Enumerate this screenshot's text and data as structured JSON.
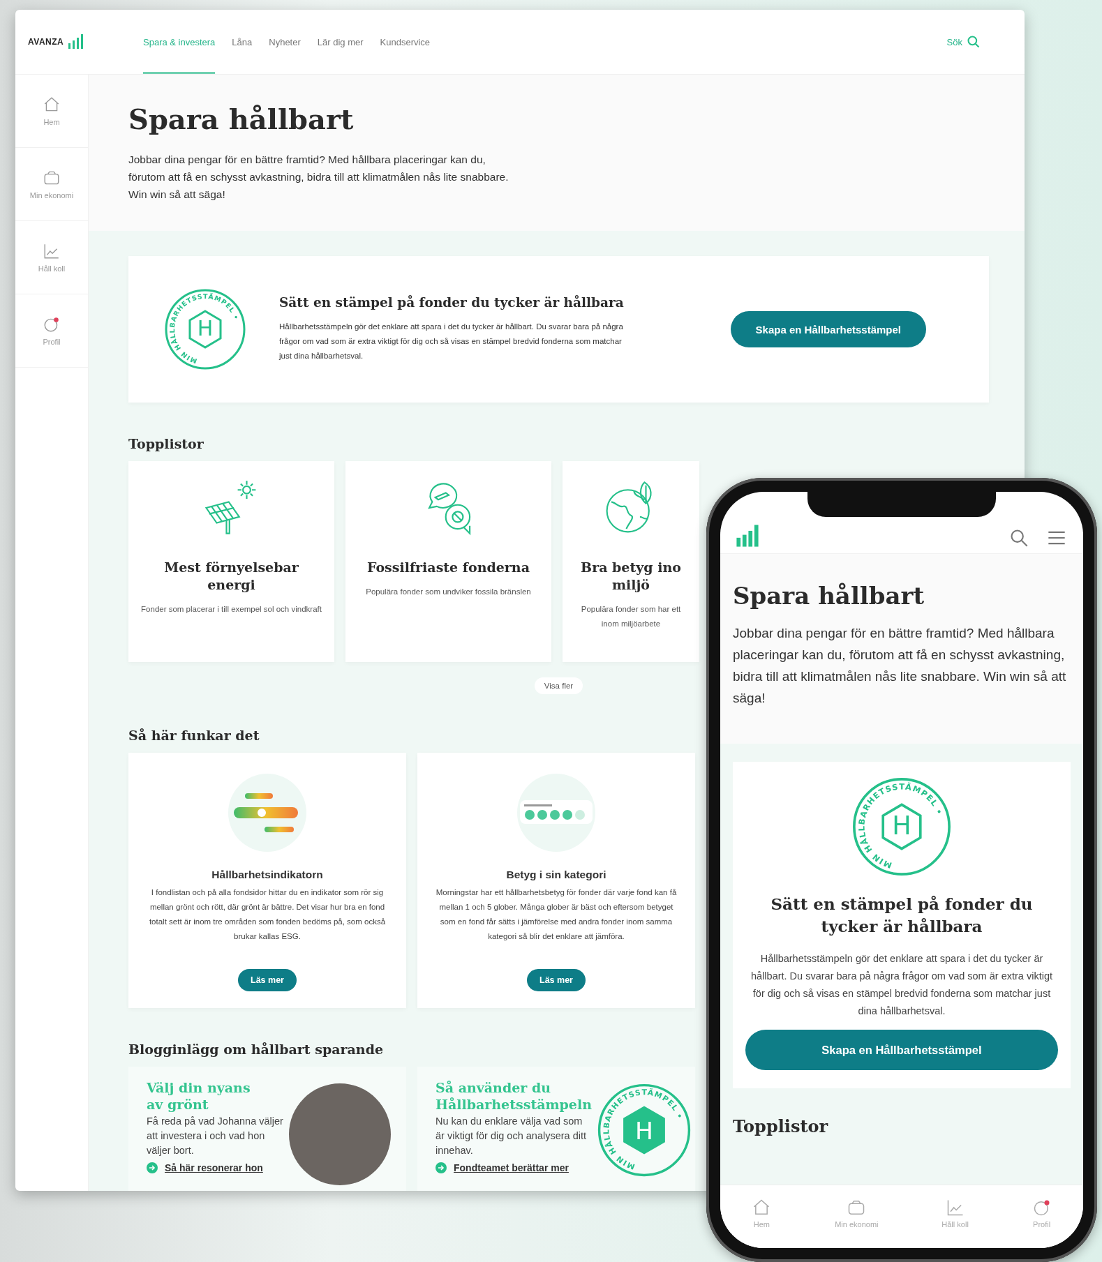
{
  "desktop": {
    "logo": "AVANZA",
    "nav": [
      {
        "label": "Spara & investera",
        "selected": true
      },
      {
        "label": "Låna",
        "selected": false
      },
      {
        "label": "Nyheter",
        "selected": false
      },
      {
        "label": "Lär dig mer",
        "selected": false
      },
      {
        "label": "Kundservice",
        "selected": false
      }
    ],
    "search_label": "Sök",
    "sidebar": [
      {
        "kind": "home",
        "label": "Hem"
      },
      {
        "kind": "wallet",
        "label": "Min ekonomi"
      },
      {
        "kind": "chart",
        "label": "Håll koll"
      },
      {
        "kind": "profile",
        "label": "Profil"
      }
    ],
    "hero": {
      "title": "Spara hållbart",
      "text": "Jobbar dina pengar för en bättre framtid? Med hållbara placeringar kan du, förutom att få en schysst avkastning, bidra till att klimatmålen nås lite snabbare. Win win så att säga!"
    },
    "stamp_card": {
      "ring_text": "MIN HÅLLBARHETSSTÄMPEL •",
      "letter": "H",
      "title": "Sätt en stämpel på fonder du tycker är hållbara",
      "text": "Hållbarhetsstämpeln gör det enklare att spara i det du tycker är hållbart. Du svarar bara på några frågor om vad som är extra viktigt för dig och så visas en stämpel bredvid fonderna som matchar just dina hållbarhetsval.",
      "button": "Skapa en Hållbarhetsstämpel"
    },
    "toplists": {
      "heading": "Topplistor",
      "cards": [
        {
          "kind": "solar",
          "title": "Mest förnyelsebar energi",
          "text": "Fonder som placerar i till exempel sol och vindkraft"
        },
        {
          "kind": "fossil",
          "title": "Fossilfriaste fonderna",
          "text": "Populära fonder som undviker fossila bränslen"
        },
        {
          "kind": "globe",
          "title": "Bra betyg ino\nmiljö",
          "text": "Populära fonder som har ett\ninom miljöarbete"
        }
      ],
      "more": "Visa fler"
    },
    "how": {
      "heading": "Så här funkar det",
      "cards": [
        {
          "kind": "indicator",
          "title": "Hållbarhetsindikatorn",
          "text": "I fondlistan och på alla fondsidor hittar du en indikator som rör sig mellan grönt och rött, där grönt är bättre. Det visar hur bra en fond totalt sett är inom tre områden som fonden bedöms på, som också brukar kallas ESG.",
          "button": "Läs mer"
        },
        {
          "kind": "rating",
          "title": "Betyg i sin kategori",
          "text": "Morningstar har ett hållbarhetsbetyg för fonder där varje fond kan få mellan 1 och 5 glober. Många glober är bäst och eftersom betyget som en fond får sätts i jämförelse med andra fonder inom samma kategori så blir det enklare att jämföra.",
          "button": "Läs mer"
        }
      ]
    },
    "blog": {
      "heading": "Blogginlägg om hållbart sparande",
      "posts": [
        {
          "kind": "photo",
          "title": "Välj din nyans av grönt",
          "text": "Få reda på vad Johanna väljer att investera i och vad hon väljer bort.",
          "link": "Så här resonerar hon"
        },
        {
          "kind": "stamp",
          "title": "Så använder du Hållbarhetsstämpeln",
          "text": "Nu kan du enklare välja vad som är viktigt för dig och analysera ditt innehav.",
          "link": "Fondteamet berättar mer",
          "ring_text": "MIN HÅLLBARHETSSTÄMPEL •",
          "letter": "H"
        }
      ]
    }
  },
  "phone": {
    "hero": {
      "title": "Spara hållbart",
      "text": "Jobbar dina pengar för en bättre framtid? Med hållbara placeringar kan du, förutom att få en schysst avkastning, bidra till att klimatmålen nås lite snabbare. Win win så att säga!"
    },
    "stamp_card": {
      "ring_text": "MIN HÅLLBARHETSSTÄMPEL •",
      "letter": "H",
      "title": "Sätt en stämpel på fonder du tycker är hållbara",
      "text": "Hållbarhetsstämpeln gör det enklare att spara i det du tycker är hållbart. Du svarar bara på några frågor om vad som är extra viktigt för dig och så visas en stämpel bredvid fonderna som matchar just dina hållbarhetsval.",
      "button": "Skapa en Hållbarhetsstämpel"
    },
    "toplists_heading": "Topplistor",
    "tabbar": [
      {
        "kind": "home",
        "label": "Hem"
      },
      {
        "kind": "wallet",
        "label": "Min ekonomi"
      },
      {
        "kind": "chart",
        "label": "Håll koll"
      },
      {
        "kind": "profile",
        "label": "Profil"
      }
    ]
  }
}
